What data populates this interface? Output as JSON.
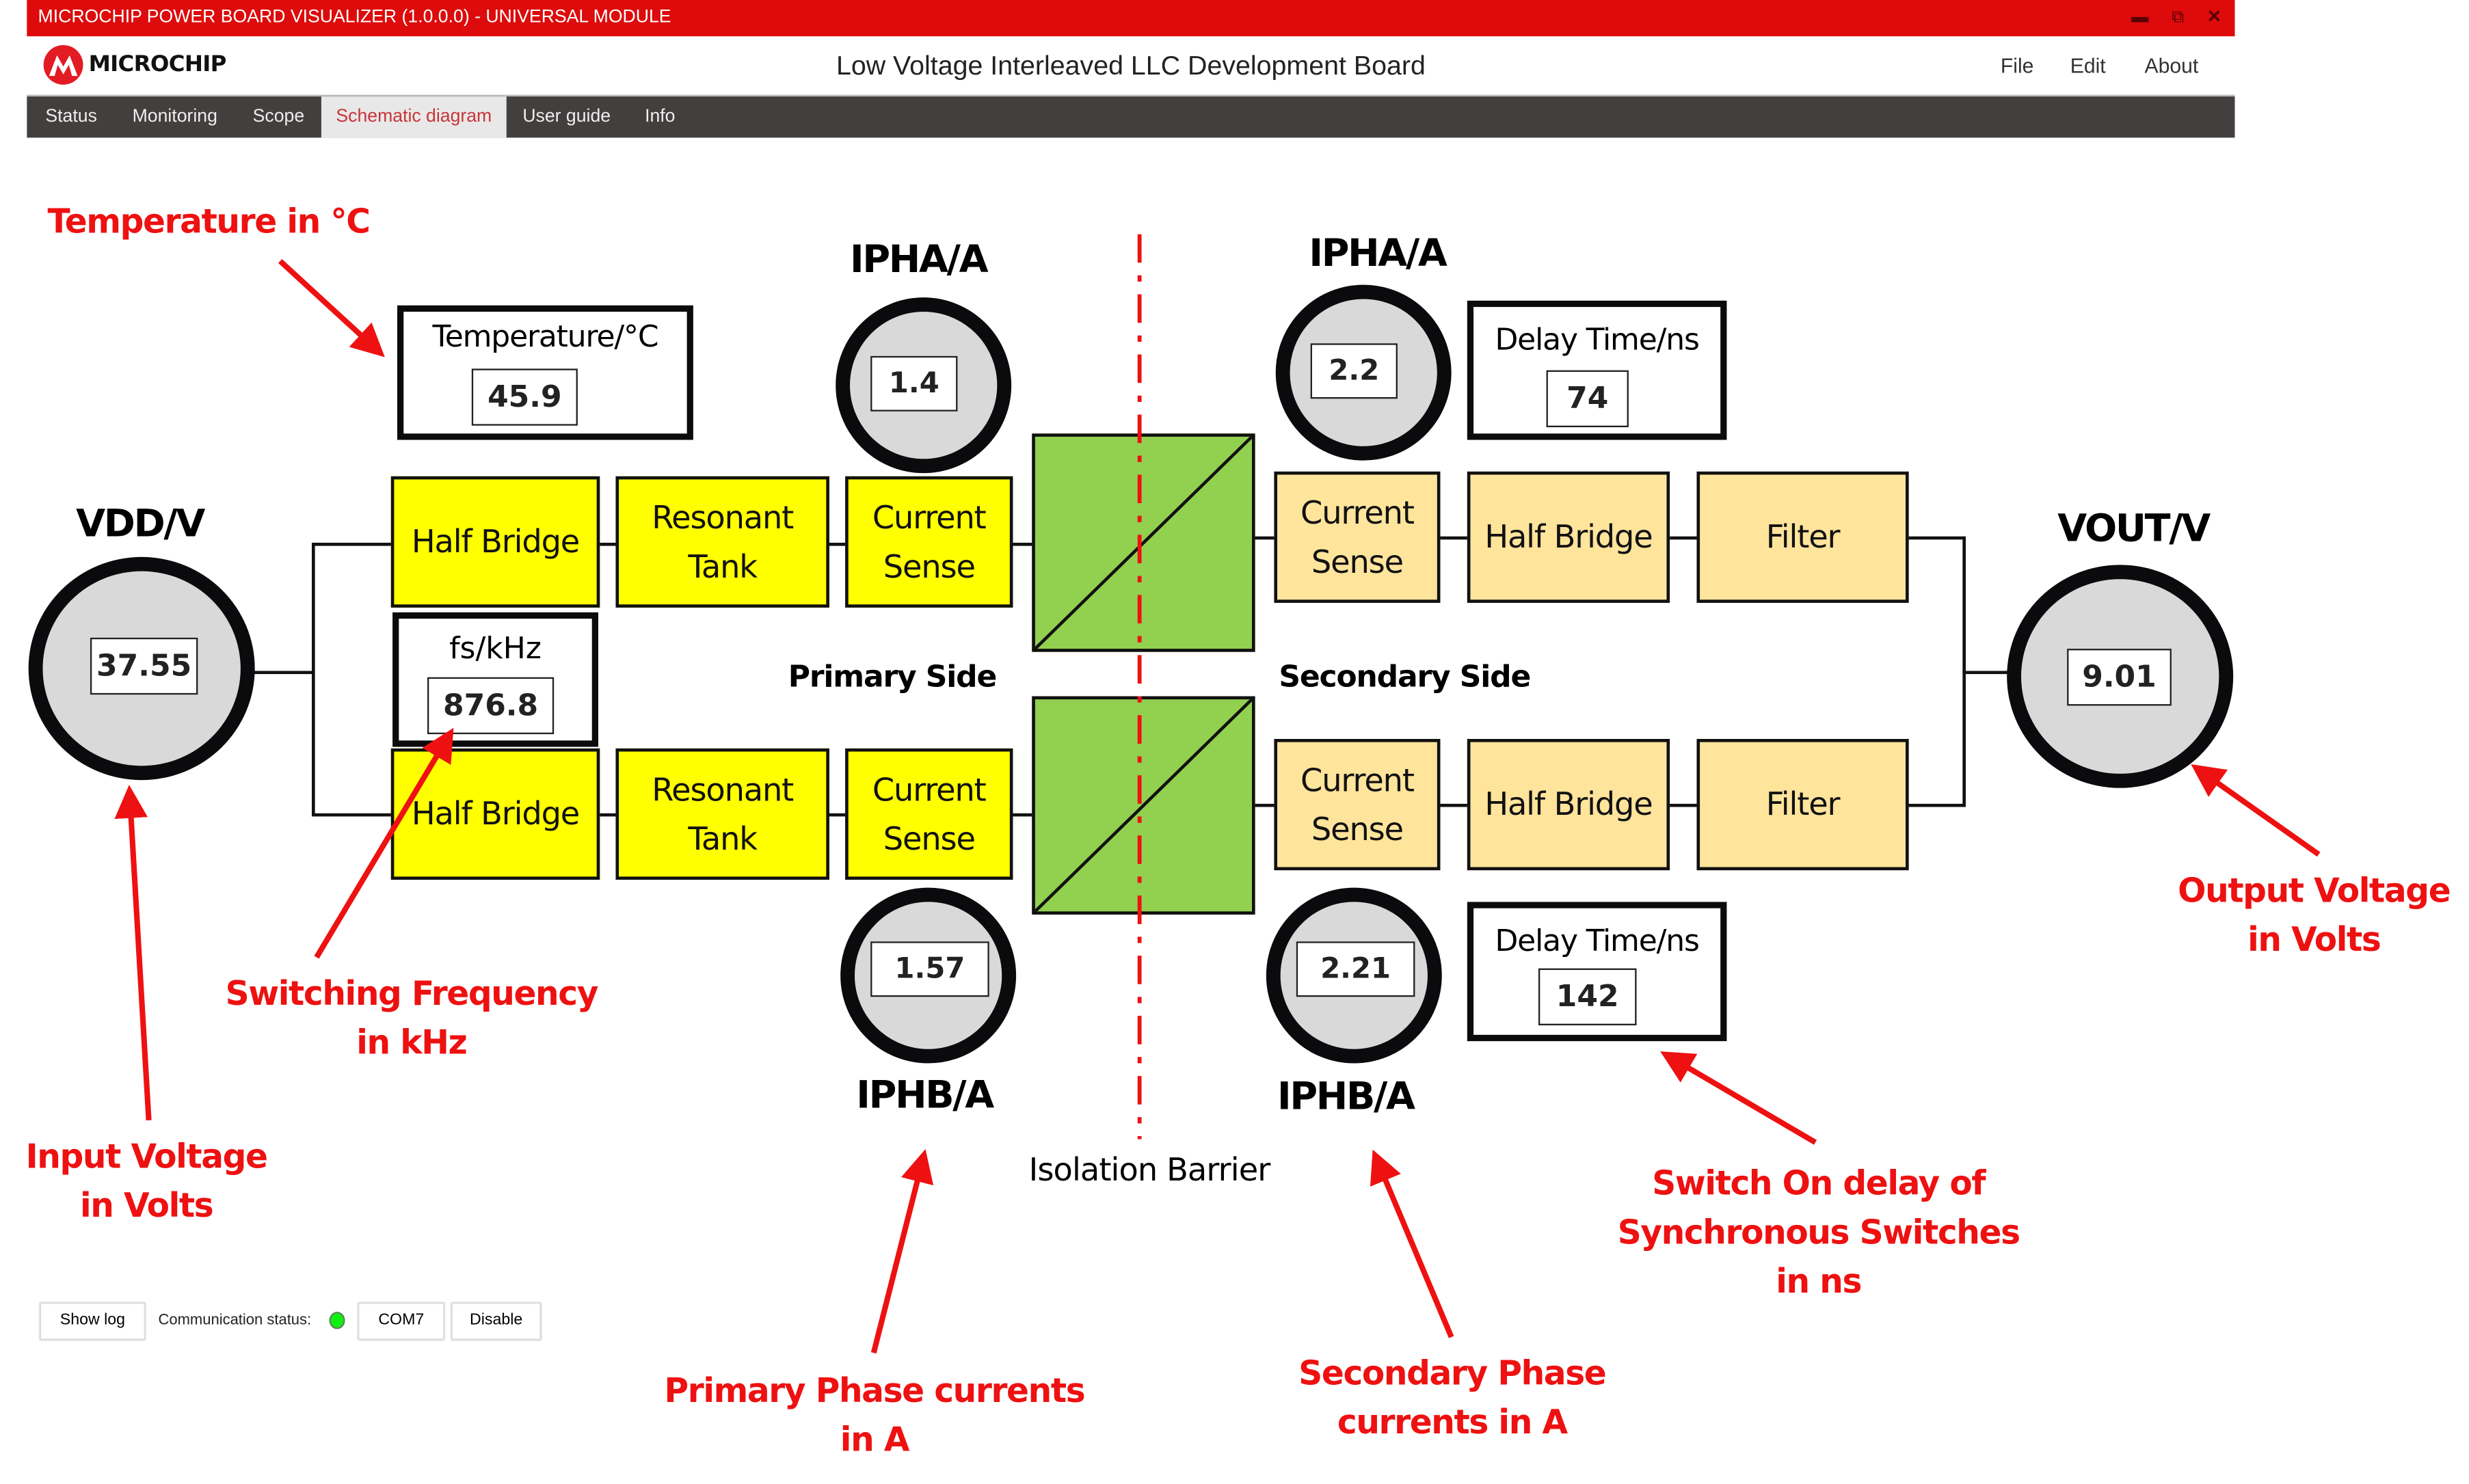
{
  "window": {
    "title": "MICROCHIP POWER BOARD VISUALIZER (1.0.0.0) - UNIVERSAL MODULE",
    "controls": {
      "minimize": "▬",
      "restore": "⧉",
      "close": "✕"
    }
  },
  "header": {
    "brand": "MICROCHIP",
    "app_title": "Low Voltage Interleaved LLC Development Board",
    "menu": [
      "File",
      "Edit",
      "About"
    ]
  },
  "tabs": [
    {
      "label": "Status",
      "active": false
    },
    {
      "label": "Monitoring",
      "active": false
    },
    {
      "label": "Scope",
      "active": false
    },
    {
      "label": "Schematic diagram",
      "active": true
    },
    {
      "label": "User guide",
      "active": false
    },
    {
      "label": "Info",
      "active": false
    }
  ],
  "diagram": {
    "vdd": {
      "label": "VDD/V",
      "value": "37.55"
    },
    "vout": {
      "label": "VOUT/V",
      "value": "9.01"
    },
    "temperature": {
      "label": "Temperature/°C",
      "value": "45.9"
    },
    "fs": {
      "label": "fs/kHz",
      "value": "876.8"
    },
    "primary_ipha": {
      "label": "IPHA/A",
      "value": "1.4"
    },
    "primary_iphb": {
      "label": "IPHB/A",
      "value": "1.57"
    },
    "secondary_ipha": {
      "label": "IPHA/A",
      "value": "2.2"
    },
    "secondary_iphb": {
      "label": "IPHB/A",
      "value": "2.21"
    },
    "delay_a": {
      "label": "Delay Time/ns",
      "value": "74"
    },
    "delay_b": {
      "label": "Delay Time/ns",
      "value": "142"
    },
    "blocks": {
      "half_bridge": "Half Bridge",
      "resonant_tank": "Resonant Tank",
      "current_sense": "Current Sense",
      "filter": "Filter"
    },
    "primary_side": "Primary Side",
    "secondary_side": "Secondary Side",
    "isolation_barrier": "Isolation Barrier",
    "colors": {
      "primary_block": "#ffff00",
      "secondary_block": "#ffe49c",
      "transformer": "#92d050",
      "meter": "#d9d9d9",
      "barrier": "#ee1111"
    }
  },
  "annotations": {
    "temperature": "Temperature in °C",
    "switching_frequency": "Switching Frequency in kHz",
    "input_voltage": "Input Voltage in Volts",
    "primary_currents": "Primary Phase currents in A",
    "secondary_currents": "Secondary Phase currents in A",
    "switch_delay": "Switch On delay of Synchronous Switches in ns",
    "output_voltage": "Output Voltage in Volts"
  },
  "footer": {
    "show_log": "Show log",
    "comm_status_label": "Communication status:",
    "comm_status": "connected",
    "port": "COM7",
    "disable": "Disable"
  }
}
